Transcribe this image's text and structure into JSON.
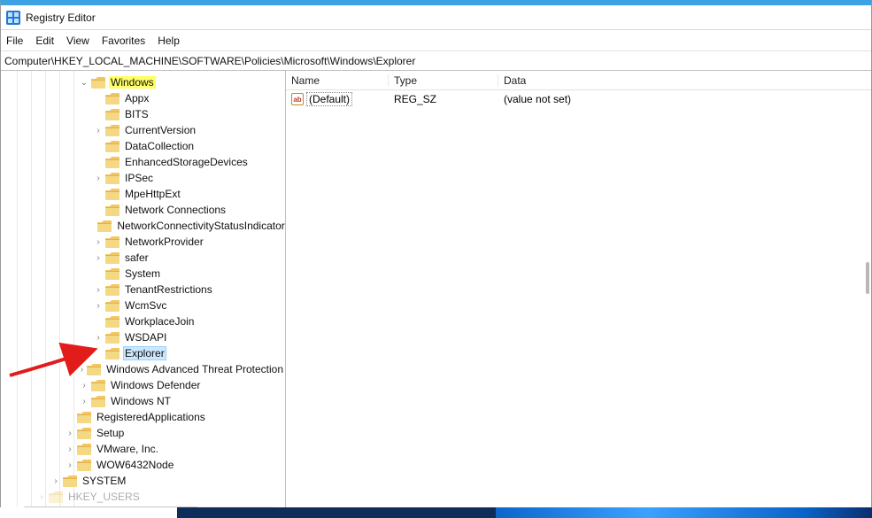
{
  "window": {
    "title": "Registry Editor"
  },
  "menu": {
    "file": "File",
    "edit": "Edit",
    "view": "View",
    "favorites": "Favorites",
    "help": "Help"
  },
  "address": {
    "path": "Computer\\HKEY_LOCAL_MACHINE\\SOFTWARE\\Policies\\Microsoft\\Windows\\Explorer"
  },
  "list": {
    "headers": {
      "name": "Name",
      "type": "Type",
      "data": "Data"
    },
    "rows": [
      {
        "icon": "ab",
        "name": "(Default)",
        "type": "REG_SZ",
        "data": "(value not set)"
      }
    ]
  },
  "tree": {
    "nodes": [
      {
        "indent": 5,
        "expander": "open",
        "label": "Windows",
        "highlight": true
      },
      {
        "indent": 6,
        "expander": "none",
        "label": "Appx"
      },
      {
        "indent": 6,
        "expander": "none",
        "label": "BITS"
      },
      {
        "indent": 6,
        "expander": "closed",
        "label": "CurrentVersion"
      },
      {
        "indent": 6,
        "expander": "none",
        "label": "DataCollection"
      },
      {
        "indent": 6,
        "expander": "none",
        "label": "EnhancedStorageDevices"
      },
      {
        "indent": 6,
        "expander": "closed",
        "label": "IPSec"
      },
      {
        "indent": 6,
        "expander": "none",
        "label": "MpeHttpExt"
      },
      {
        "indent": 6,
        "expander": "none",
        "label": "Network Connections"
      },
      {
        "indent": 6,
        "expander": "none",
        "label": "NetworkConnectivityStatusIndicator"
      },
      {
        "indent": 6,
        "expander": "closed",
        "label": "NetworkProvider"
      },
      {
        "indent": 6,
        "expander": "closed",
        "label": "safer"
      },
      {
        "indent": 6,
        "expander": "none",
        "label": "System"
      },
      {
        "indent": 6,
        "expander": "closed",
        "label": "TenantRestrictions"
      },
      {
        "indent": 6,
        "expander": "closed",
        "label": "WcmSvc"
      },
      {
        "indent": 6,
        "expander": "none",
        "label": "WorkplaceJoin"
      },
      {
        "indent": 6,
        "expander": "closed",
        "label": "WSDAPI"
      },
      {
        "indent": 6,
        "expander": "none",
        "label": "Explorer",
        "selected": true
      },
      {
        "indent": 5,
        "expander": "closed",
        "label": "Windows Advanced Threat Protection"
      },
      {
        "indent": 5,
        "expander": "closed",
        "label": "Windows Defender"
      },
      {
        "indent": 5,
        "expander": "closed",
        "label": "Windows NT"
      },
      {
        "indent": 4,
        "expander": "none",
        "label": "RegisteredApplications"
      },
      {
        "indent": 4,
        "expander": "closed",
        "label": "Setup"
      },
      {
        "indent": 4,
        "expander": "closed",
        "label": "VMware, Inc."
      },
      {
        "indent": 4,
        "expander": "closed",
        "label": "WOW6432Node"
      },
      {
        "indent": 3,
        "expander": "closed",
        "label": "SYSTEM"
      },
      {
        "indent": 2,
        "expander": "closed",
        "label": "HKEY_USERS",
        "faded": true
      }
    ]
  }
}
